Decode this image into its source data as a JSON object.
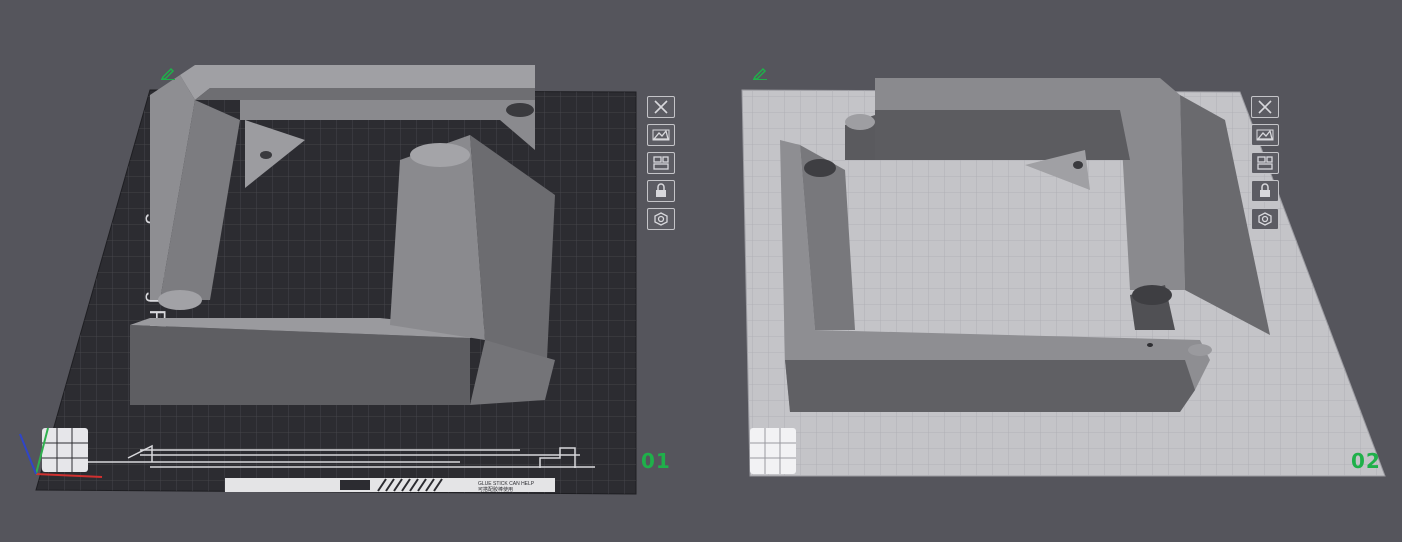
{
  "plates": [
    {
      "number": "01",
      "type_label": "Bambu Engineering Plate",
      "footer_note": "GLUE STICK CAN HELP",
      "footer_note_cn": "可搭配胶棒使用",
      "plate_color": "#2c2c31",
      "tools": [
        "close-icon",
        "auto-orient-icon",
        "arrange-icon",
        "lock-icon",
        "settings-icon"
      ]
    },
    {
      "number": "02",
      "plate_color": "#c4c4c8",
      "tools": [
        "close-icon",
        "auto-orient-icon",
        "arrange-icon",
        "lock-icon",
        "settings-icon"
      ]
    }
  ],
  "colors": {
    "background": "#55555c",
    "accent_green": "#1fb04a",
    "model_gray": "#7c7c80"
  }
}
